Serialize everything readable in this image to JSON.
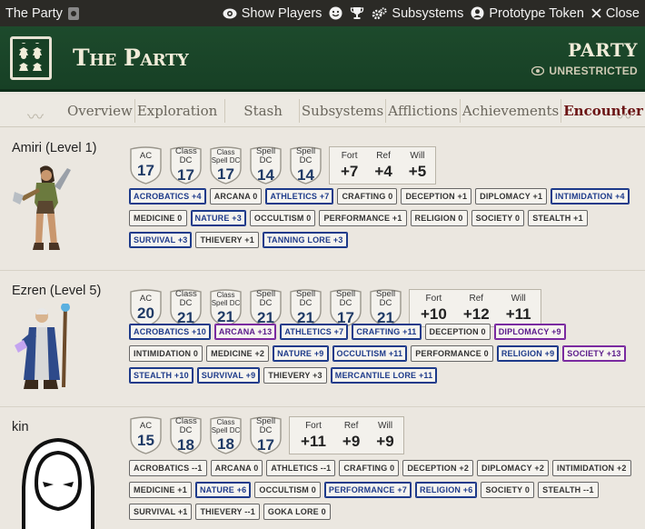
{
  "window": {
    "title": "The Party",
    "buttons": [
      {
        "label": "Show Players",
        "icon": "eye-icon"
      },
      {
        "label": "",
        "icon": "smiley-icon"
      },
      {
        "label": "",
        "icon": "trophy-icon"
      },
      {
        "label": "Subsystems",
        "icon": "gears-icon"
      },
      {
        "label": "Prototype Token",
        "icon": "user-circle-icon"
      },
      {
        "label": "Close",
        "icon": "close-icon"
      }
    ]
  },
  "header": {
    "title": "The Party",
    "type": "PARTY",
    "visibility": "UNRESTRICTED",
    "colors": {
      "bg": "#1d4a2c",
      "text": "#f1ecd9"
    }
  },
  "nav": {
    "tabs": [
      "Overview",
      "Exploration",
      "Stash",
      "Subsystems",
      "Afflictions",
      "Achievements",
      "Encounter"
    ],
    "active": "Encounter"
  },
  "members": [
    {
      "name": "Amiri (Level 1)",
      "defenses": [
        {
          "label": "AC",
          "value": "17"
        },
        {
          "label": "Class DC",
          "value": "17"
        },
        {
          "label": "Class Spell DC",
          "value": "17"
        },
        {
          "label": "Spell DC",
          "value": "14"
        },
        {
          "label": "Spell DC",
          "value": "14"
        }
      ],
      "saves": [
        {
          "label": "Fort",
          "value": "+7"
        },
        {
          "label": "Ref",
          "value": "+4"
        },
        {
          "label": "Will",
          "value": "+5"
        }
      ],
      "skills": [
        {
          "label": "ACROBATICS +4",
          "rank": "trained"
        },
        {
          "label": "ARCANA 0",
          "rank": "untrained"
        },
        {
          "label": "ATHLETICS +7",
          "rank": "trained"
        },
        {
          "label": "CRAFTING 0",
          "rank": "untrained"
        },
        {
          "label": "DECEPTION +1",
          "rank": "untrained"
        },
        {
          "label": "DIPLOMACY +1",
          "rank": "untrained"
        },
        {
          "label": "INTIMIDATION +4",
          "rank": "trained"
        },
        {
          "label": "MEDICINE 0",
          "rank": "untrained"
        },
        {
          "label": "NATURE +3",
          "rank": "trained"
        },
        {
          "label": "OCCULTISM 0",
          "rank": "untrained"
        },
        {
          "label": "PERFORMANCE +1",
          "rank": "untrained"
        },
        {
          "label": "RELIGION 0",
          "rank": "untrained"
        },
        {
          "label": "SOCIETY 0",
          "rank": "untrained"
        },
        {
          "label": "STEALTH +1",
          "rank": "untrained"
        },
        {
          "label": "SURVIVAL +3",
          "rank": "trained"
        },
        {
          "label": "THIEVERY +1",
          "rank": "untrained"
        },
        {
          "label": "TANNING LORE +3",
          "rank": "trained"
        }
      ]
    },
    {
      "name": "Ezren (Level 5)",
      "defenses": [
        {
          "label": "AC",
          "value": "20"
        },
        {
          "label": "Class DC",
          "value": "21"
        },
        {
          "label": "Class Spell DC",
          "value": "21"
        },
        {
          "label": "Spell DC",
          "value": "21"
        },
        {
          "label": "Spell DC",
          "value": "21"
        },
        {
          "label": "Spell DC",
          "value": "17"
        },
        {
          "label": "Spell DC",
          "value": "21"
        }
      ],
      "saves": [
        {
          "label": "Fort",
          "value": "+10"
        },
        {
          "label": "Ref",
          "value": "+12"
        },
        {
          "label": "Will",
          "value": "+11"
        }
      ],
      "skills": [
        {
          "label": "ACROBATICS +10",
          "rank": "trained"
        },
        {
          "label": "ARCANA +13",
          "rank": "expert"
        },
        {
          "label": "ATHLETICS +7",
          "rank": "trained"
        },
        {
          "label": "CRAFTING +11",
          "rank": "trained"
        },
        {
          "label": "DECEPTION 0",
          "rank": "untrained"
        },
        {
          "label": "DIPLOMACY +9",
          "rank": "expert"
        },
        {
          "label": "INTIMIDATION 0",
          "rank": "untrained"
        },
        {
          "label": "MEDICINE +2",
          "rank": "untrained"
        },
        {
          "label": "NATURE +9",
          "rank": "trained"
        },
        {
          "label": "OCCULTISM +11",
          "rank": "trained"
        },
        {
          "label": "PERFORMANCE 0",
          "rank": "untrained"
        },
        {
          "label": "RELIGION +9",
          "rank": "trained"
        },
        {
          "label": "SOCIETY +13",
          "rank": "expert"
        },
        {
          "label": "STEALTH +10",
          "rank": "trained"
        },
        {
          "label": "SURVIVAL +9",
          "rank": "trained"
        },
        {
          "label": "THIEVERY +3",
          "rank": "untrained"
        },
        {
          "label": "MERCANTILE LORE +11",
          "rank": "trained"
        }
      ]
    },
    {
      "name": "kin",
      "defenses": [
        {
          "label": "AC",
          "value": "15"
        },
        {
          "label": "Class DC",
          "value": "18"
        },
        {
          "label": "Class Spell DC",
          "value": "18"
        },
        {
          "label": "Spell DC",
          "value": "17"
        }
      ],
      "saves": [
        {
          "label": "Fort",
          "value": "+11"
        },
        {
          "label": "Ref",
          "value": "+9"
        },
        {
          "label": "Will",
          "value": "+9"
        }
      ],
      "skills": [
        {
          "label": "ACROBATICS --1",
          "rank": "untrained"
        },
        {
          "label": "ARCANA 0",
          "rank": "untrained"
        },
        {
          "label": "ATHLETICS --1",
          "rank": "untrained"
        },
        {
          "label": "CRAFTING 0",
          "rank": "untrained"
        },
        {
          "label": "DECEPTION +2",
          "rank": "untrained"
        },
        {
          "label": "DIPLOMACY +2",
          "rank": "untrained"
        },
        {
          "label": "INTIMIDATION +2",
          "rank": "untrained"
        },
        {
          "label": "MEDICINE +1",
          "rank": "untrained"
        },
        {
          "label": "NATURE +6",
          "rank": "trained"
        },
        {
          "label": "OCCULTISM 0",
          "rank": "untrained"
        },
        {
          "label": "PERFORMANCE +7",
          "rank": "trained"
        },
        {
          "label": "RELIGION +6",
          "rank": "trained"
        },
        {
          "label": "SOCIETY 0",
          "rank": "untrained"
        },
        {
          "label": "STEALTH --1",
          "rank": "untrained"
        },
        {
          "label": "SURVIVAL +1",
          "rank": "untrained"
        },
        {
          "label": "THIEVERY --1",
          "rank": "untrained"
        },
        {
          "label": "GOKA LORE 0",
          "rank": "untrained"
        }
      ]
    }
  ]
}
